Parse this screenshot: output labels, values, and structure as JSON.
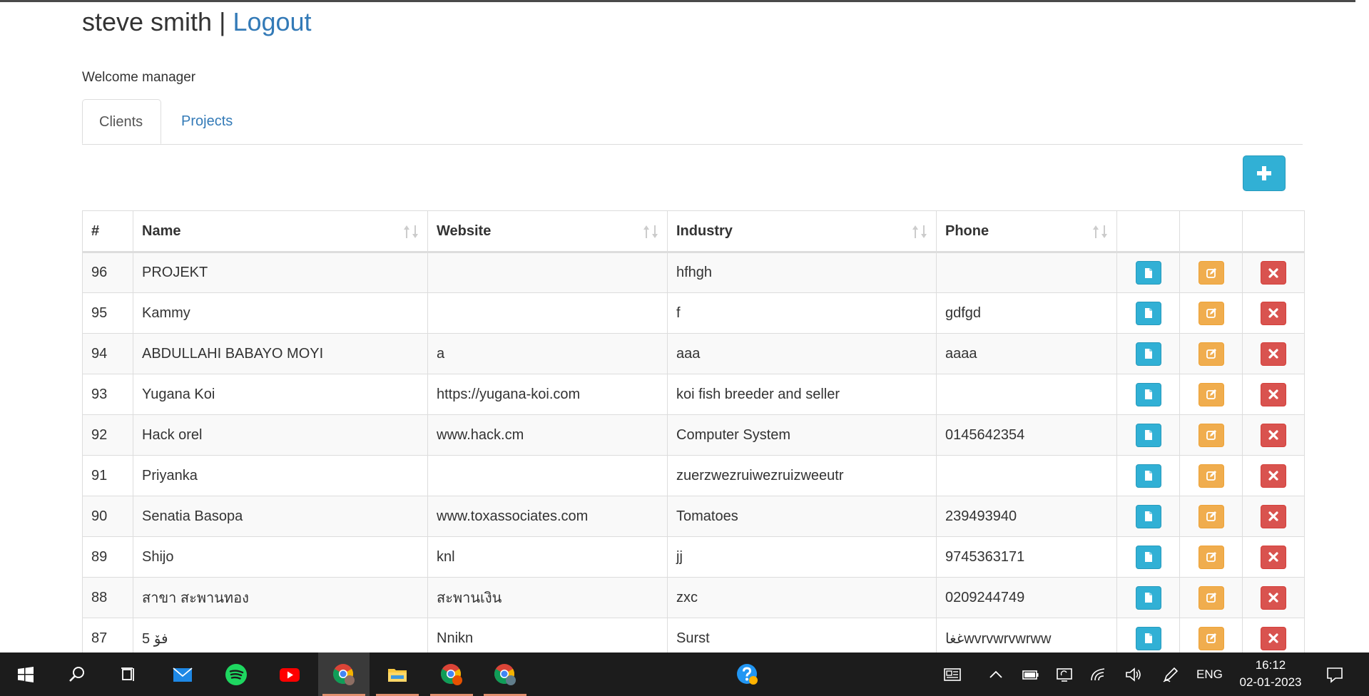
{
  "header": {
    "user_name": "steve smith",
    "separator": "|",
    "logout_label": "Logout"
  },
  "welcome_text": "Welcome manager",
  "tabs": [
    {
      "label": "Clients",
      "active": true
    },
    {
      "label": "Projects",
      "active": false
    }
  ],
  "add_button": {
    "icon": "plus-icon"
  },
  "table": {
    "columns": [
      "#",
      "Name",
      "Website",
      "Industry",
      "Phone",
      "",
      "",
      ""
    ],
    "sortable_columns": [
      "Name",
      "Website",
      "Industry",
      "Phone"
    ],
    "rows": [
      {
        "id": "96",
        "name": "PROJEKT",
        "website": "",
        "industry": "hfhgh",
        "phone": ""
      },
      {
        "id": "95",
        "name": "Kammy",
        "website": "",
        "industry": "f",
        "phone": "gdfgd"
      },
      {
        "id": "94",
        "name": "ABDULLAHI BABAYO MOYI",
        "website": "a",
        "industry": "aaa",
        "phone": "aaaa"
      },
      {
        "id": "93",
        "name": "Yugana Koi",
        "website": "https://yugana-koi.com",
        "industry": "koi fish breeder and seller",
        "phone": ""
      },
      {
        "id": "92",
        "name": "Hack orel",
        "website": "www.hack.cm",
        "industry": "Computer System",
        "phone": "0145642354"
      },
      {
        "id": "91",
        "name": "Priyanka",
        "website": "",
        "industry": "zuerzwezruiwezruizweeutr",
        "phone": ""
      },
      {
        "id": "90",
        "name": "Senatia Basopa",
        "website": "www.toxassociates.com",
        "industry": "Tomatoes",
        "phone": "239493940"
      },
      {
        "id": "89",
        "name": "Shijo",
        "website": "knl",
        "industry": "jj",
        "phone": "9745363171"
      },
      {
        "id": "88",
        "name": "สาขา สะพานทอง",
        "website": "สะพานเงิน",
        "industry": "zxc",
        "phone": "0209244749"
      },
      {
        "id": "87",
        "name": "5 فۆ",
        "website": "Nnikn",
        "industry": "Surst",
        "phone": "غغاwvrvwrvwrww"
      }
    ],
    "row_action_icons": [
      "file-icon",
      "edit-icon",
      "close-icon"
    ]
  },
  "taskbar": {
    "apps": [
      "windows-start-icon",
      "search-icon",
      "task-view-icon",
      "mail-icon",
      "spotify-icon",
      "youtube-icon",
      "chrome-profile-s-icon",
      "file-explorer-icon",
      "chrome-profile-s-icon",
      "chrome-profile-g-icon",
      "help-icon"
    ],
    "language": "ENG",
    "time": "16:12",
    "date": "02-01-2023"
  },
  "colors": {
    "link": "#337ab7",
    "info": "#31b0d5",
    "warning": "#f0ad4e",
    "danger": "#d9534f",
    "taskbar": "#1c1c1c"
  }
}
